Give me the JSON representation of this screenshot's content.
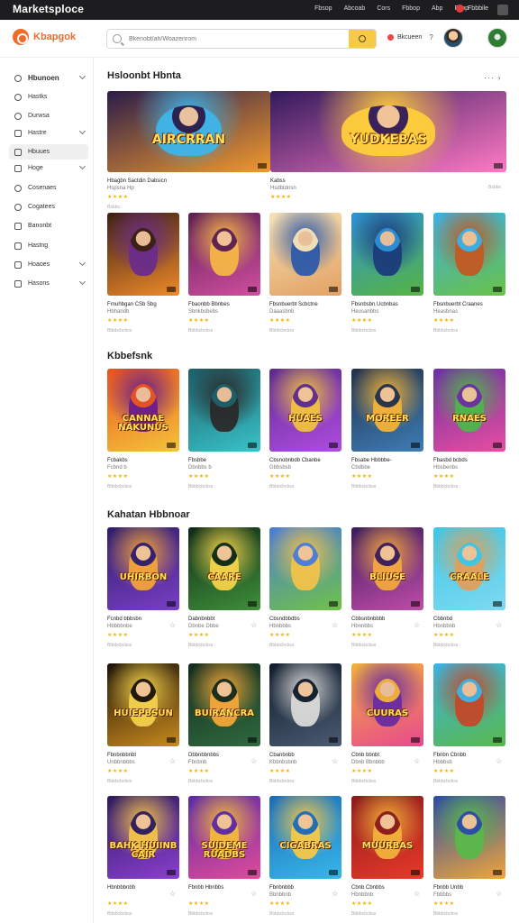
{
  "topbar": {
    "title": "Marketsploce",
    "links": [
      "Fbsop",
      "Abcoab",
      "Cors",
      "Fbbop",
      "Abp",
      "Fsop"
    ],
    "user": "Fbbbile"
  },
  "header": {
    "brand": "Kbapgok",
    "search_placeholder": "Bkenobt/ah/Woazenrom",
    "account_label": "Bkcueen",
    "help": "?"
  },
  "sidebar": {
    "items": [
      {
        "label": "Hbunoen",
        "icon": "home-icon"
      },
      {
        "label": "Hastks",
        "icon": "brush-icon"
      },
      {
        "label": "Durwsa",
        "icon": "pen-icon"
      },
      {
        "label": "Hastre",
        "icon": "grid-icon"
      },
      {
        "label": "Hbuues",
        "icon": "store-icon"
      },
      {
        "label": "Hoge",
        "icon": "tag-icon"
      },
      {
        "label": "Cosenaes",
        "icon": "chat-icon"
      },
      {
        "label": "Cogatees",
        "icon": "box-icon"
      },
      {
        "label": "Banonbt",
        "icon": "map-icon"
      },
      {
        "label": "Hastng",
        "icon": "cube-icon"
      },
      {
        "label": "Hoaoes",
        "icon": "bag-icon"
      },
      {
        "label": "Hasons",
        "icon": "folder-icon"
      }
    ]
  },
  "sections": {
    "featured": "Hsloonbt Hbnta",
    "row2": "Kbbefsnk",
    "row3": "Kahatan Hbbnoar"
  },
  "featured_cards": [
    {
      "art": "AIRCRRAN",
      "title": "Hbagbn Sactdin Dabsicn",
      "sub": "Hspsna Hp",
      "meta": "Bsbbs",
      "palette": [
        "#2b1c49",
        "#f29a2e",
        "#3fb4e8"
      ]
    },
    {
      "art": "YUDKEBAS",
      "title": "Kabss",
      "sub": "Hsdbtdnsn",
      "meta": "Bsbbs",
      "palette": [
        "#311a5c",
        "#ff7ac4",
        "#ffce3a"
      ]
    }
  ],
  "grid_row1": [
    {
      "art": "",
      "title": "Frnuhbgan CSb Sbg",
      "sub": "Hbhandb",
      "meta": "Bbbbcbcbss",
      "palette": [
        "#3a2013",
        "#f08a2a",
        "#6b2c8a"
      ]
    },
    {
      "art": "",
      "title": "Fbaonbb Bbnbes",
      "sub": "Sbnkbsbebs",
      "meta": "Bbbbcbcbss",
      "palette": [
        "#5a1e52",
        "#d14fa0",
        "#f5b547"
      ]
    },
    {
      "art": "",
      "title": "Fbsnbuerbt Scbctne",
      "sub": "Daaasbnb",
      "meta": "Bbbbcbcbss",
      "palette": [
        "#f6e3b8",
        "#e2a062",
        "#2f5aa8"
      ]
    },
    {
      "art": "",
      "title": "Fbsnbsbn Ucbnbas",
      "sub": "Heusanbbs",
      "meta": "Bbbbcbcbss",
      "palette": [
        "#2f8fd5",
        "#55b541",
        "#1b3c7a"
      ]
    },
    {
      "art": "",
      "title": "Fbsnbuerbt Craanes",
      "sub": "Heasbnas",
      "meta": "Bbbbcbcbss",
      "palette": [
        "#3bb0e8",
        "#6ac245",
        "#c05a22"
      ]
    }
  ],
  "grid_row2": [
    {
      "art": "CANNAE NAKUNUS",
      "title": "Fcbakbs",
      "sub": "Fcbnd b",
      "meta": "Bbbbcbcbss",
      "palette": [
        "#e8541f",
        "#f4c43a",
        "#6b1d8a"
      ]
    },
    {
      "art": "",
      "title": "Fbsbbe",
      "sub": "Dbnbbs b",
      "meta": "Bbbbcbcbss",
      "palette": [
        "#1d5f6a",
        "#39c3c9",
        "#2a2a2a"
      ]
    },
    {
      "art": "HUAES",
      "title": "Cbsnobnbdb Cbanbe",
      "sub": "Gbbsbsb",
      "meta": "Bbbbcbcbss",
      "palette": [
        "#5c2a8e",
        "#b04de0",
        "#f0c040"
      ]
    },
    {
      "art": "MOREER",
      "title": "Fbsabe Hbbbbe-",
      "sub": "Cbdbbe",
      "meta": "Bbbbcbcbss",
      "palette": [
        "#21304a",
        "#3e7db6",
        "#f2b23a"
      ]
    },
    {
      "art": "RNAES",
      "title": "Fbasbd bcbds",
      "sub": "Hbsbenbs",
      "meta": "Bbbbcbcbss",
      "palette": [
        "#6b2fa4",
        "#e84ea0",
        "#50b44a"
      ]
    }
  ],
  "grid_row3": [
    {
      "art": "UHIRBON",
      "title": "Fcnbd bbbsbn",
      "sub": "Hbbbbnbe",
      "meta": "Bbbbcbcbss",
      "palette": [
        "#2d1d6b",
        "#7a3fc4",
        "#f2a23a"
      ]
    },
    {
      "art": "CAARE",
      "title": "Dabnbnbbt",
      "sub": "Dbnbe Dbbe",
      "meta": "Bbbbcbcbss",
      "palette": [
        "#0e2a16",
        "#3f8f3a",
        "#f2d24a"
      ]
    },
    {
      "art": "",
      "title": "Cbsndbbdbs",
      "sub": "Hbnbbbs",
      "meta": "Bbbbcbcbss",
      "palette": [
        "#4a7bd8",
        "#6fc247",
        "#f0c24a"
      ]
    },
    {
      "art": "BLIUSE",
      "title": "Cbbsnbnbbbb",
      "sub": "Hbnnbbs",
      "meta": "Bbbbcbcbss",
      "palette": [
        "#3a1b5c",
        "#c04ca8",
        "#f2a640"
      ]
    },
    {
      "art": "CRAALE",
      "title": "Cbbnbd",
      "sub": "Hbnbbnb",
      "meta": "Bbbbcbcbss",
      "palette": [
        "#3ac7e8",
        "#7fd9f0",
        "#e0a05a"
      ]
    }
  ],
  "grid_row4": [
    {
      "art": "HUIEPBSUN",
      "title": "Fbnbnbbnbt",
      "sub": "Unbbnbbbs",
      "meta": "Bbbbcbcbss",
      "palette": [
        "#1a1208",
        "#c88a1e",
        "#f2d04a"
      ]
    },
    {
      "art": "BUIRANCRA",
      "title": "Dbbnbbnbbs",
      "sub": "Fbnbnb",
      "meta": "Bbbbcbcbss",
      "palette": [
        "#132a1c",
        "#2f6a3f",
        "#f2a63a"
      ]
    },
    {
      "art": "",
      "title": "Cbanbnbb",
      "sub": "Kbbnbsbnb",
      "meta": "Bbbbcbcbss",
      "palette": [
        "#0f1b2a",
        "#4a5a70",
        "#d8d8d8"
      ]
    },
    {
      "art": "CUURAS",
      "title": "Cbnb bbnbt",
      "sub": "Dbnb Bbnbbb",
      "meta": "Bbbbcbcbss",
      "palette": [
        "#f2b23a",
        "#e8488f",
        "#6a2ca0"
      ]
    },
    {
      "art": "",
      "title": "Fbnbn Cbnbb",
      "sub": "Hbbbsb",
      "meta": "Bbbbcbcbss",
      "palette": [
        "#3bb3e6",
        "#59b84a",
        "#c04a2a"
      ]
    }
  ],
  "grid_row5": [
    {
      "art": "BAHK HUIINB CAIR",
      "title": "Hbnbbbnbb",
      "sub": "",
      "meta": "Bbbbcbcbss",
      "palette": [
        "#2b1b5c",
        "#8b3fd0",
        "#f2c24a"
      ]
    },
    {
      "art": "SUIDEME RUADBS",
      "title": "Fbnbb Hbnbbs",
      "sub": "",
      "meta": "Bbbbcbcbss",
      "palette": [
        "#5a2aa6",
        "#e04c9a",
        "#f2b83a"
      ]
    },
    {
      "art": "CIGABRAS",
      "title": "Fbnbnbbb",
      "sub": "Bbnbbnb",
      "meta": "Bbbbcbcbss",
      "palette": [
        "#1b6bb8",
        "#38b7e8",
        "#f2c84a"
      ]
    },
    {
      "art": "MUURBAS",
      "title": "Cbnb Cbnbbs",
      "sub": "Hbnbbnb",
      "meta": "Bbbbcbcbss",
      "palette": [
        "#8a1a1a",
        "#e83a2a",
        "#f2b03a"
      ]
    },
    {
      "art": "",
      "title": "Fbnbb Unbb",
      "sub": "Fbbbbs",
      "meta": "Bbbbcbcbss",
      "palette": [
        "#2a4aa8",
        "#f0a63a",
        "#5ab84a"
      ]
    }
  ],
  "ratings": {
    "full_stars": "★★★★",
    "empty_star": "☆",
    "featured_stars": "★★★★"
  }
}
